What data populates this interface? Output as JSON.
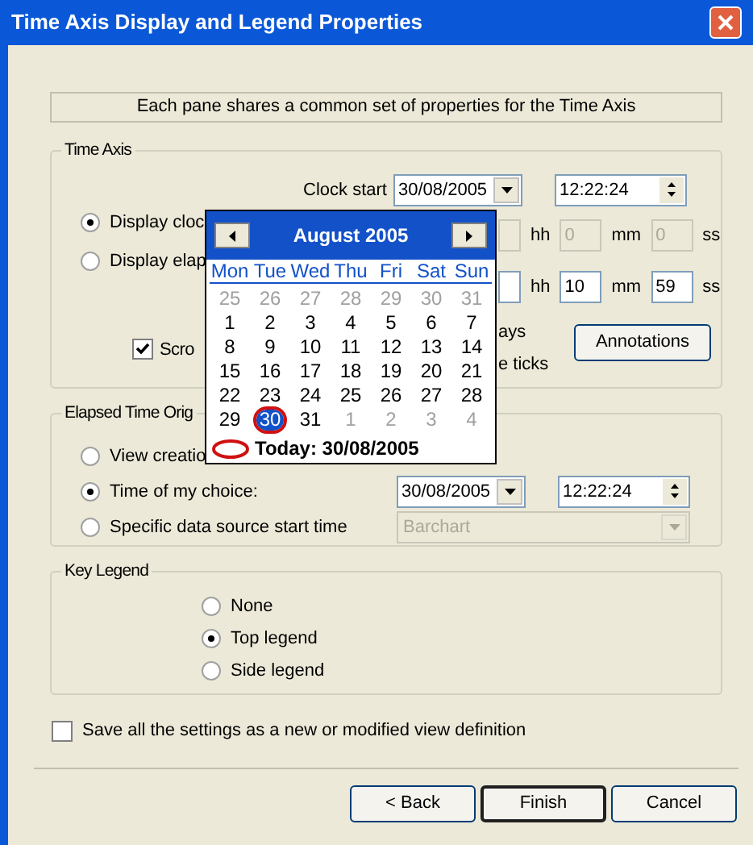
{
  "window": {
    "title": "Time Axis Display and Legend Properties"
  },
  "banner": "Each pane shares a common set of properties for the Time Axis",
  "time_axis": {
    "title": "Time Axis",
    "clock_start": {
      "label": "Clock start",
      "date": "30/08/2005",
      "time": "12:22:24"
    },
    "modes": [
      {
        "label": "Display cloc",
        "selected": true
      },
      {
        "label": "Display elap",
        "selected": false
      }
    ],
    "offset_rows": [
      {
        "disabled": true,
        "items": [
          {
            "kind": "field"
          },
          {
            "kind": "unit",
            "text": "hh"
          },
          {
            "kind": "field",
            "value": "0"
          },
          {
            "kind": "unit",
            "text": "mm"
          },
          {
            "kind": "field",
            "value": "0"
          },
          {
            "kind": "unit",
            "text": "ss"
          }
        ]
      },
      {
        "disabled": false,
        "items": [
          {
            "kind": "field"
          },
          {
            "kind": "unit",
            "text": "hh"
          },
          {
            "kind": "field",
            "value": "10"
          },
          {
            "kind": "unit",
            "text": "mm"
          },
          {
            "kind": "field",
            "value": "59"
          },
          {
            "kind": "unit",
            "text": "ss"
          }
        ]
      }
    ],
    "scroll_checkbox": {
      "label": "Scro",
      "checked": true
    },
    "partial_labels": [
      "ays",
      "e ticks"
    ],
    "annotations_button": "Annotations"
  },
  "elapsed_origin": {
    "title": "Elapsed Time Orig",
    "options": [
      {
        "kind": "plain",
        "label": "View creatio",
        "selected": false
      },
      {
        "kind": "datetime",
        "label": "Time of my choice:",
        "selected": true,
        "date": "30/08/2005",
        "time": "12:22:24"
      },
      {
        "kind": "source",
        "label": "Specific data source start time",
        "selected": false,
        "source": {
          "value": "Barchart",
          "disabled": true
        }
      }
    ]
  },
  "key_legend": {
    "title": "Key Legend",
    "options": [
      {
        "label": "None",
        "selected": false
      },
      {
        "label": "Top legend",
        "selected": true
      },
      {
        "label": "Side legend",
        "selected": false
      }
    ]
  },
  "save_checkbox": {
    "label": "Save all the settings as a new or modified view definition",
    "checked": false
  },
  "buttons": [
    {
      "label": "< Back",
      "default": false
    },
    {
      "label": "Finish",
      "default": true
    },
    {
      "label": "Cancel",
      "default": false
    }
  ],
  "calendar": {
    "month": "August 2005",
    "weekdays": [
      "Mon",
      "Tue",
      "Wed",
      "Thu",
      "Fri",
      "Sat",
      "Sun"
    ],
    "days": [
      {
        "day": "25",
        "other_month": true,
        "selected": false
      },
      {
        "day": "26",
        "other_month": true,
        "selected": false
      },
      {
        "day": "27",
        "other_month": true,
        "selected": false
      },
      {
        "day": "28",
        "other_month": true,
        "selected": false
      },
      {
        "day": "29",
        "other_month": true,
        "selected": false
      },
      {
        "day": "30",
        "other_month": true,
        "selected": false
      },
      {
        "day": "31",
        "other_month": true,
        "selected": false
      },
      {
        "day": "1",
        "other_month": false,
        "selected": false
      },
      {
        "day": "2",
        "other_month": false,
        "selected": false
      },
      {
        "day": "3",
        "other_month": false,
        "selected": false
      },
      {
        "day": "4",
        "other_month": false,
        "selected": false
      },
      {
        "day": "5",
        "other_month": false,
        "selected": false
      },
      {
        "day": "6",
        "other_month": false,
        "selected": false
      },
      {
        "day": "7",
        "other_month": false,
        "selected": false
      },
      {
        "day": "8",
        "other_month": false,
        "selected": false
      },
      {
        "day": "9",
        "other_month": false,
        "selected": false
      },
      {
        "day": "10",
        "other_month": false,
        "selected": false
      },
      {
        "day": "11",
        "other_month": false,
        "selected": false
      },
      {
        "day": "12",
        "other_month": false,
        "selected": false
      },
      {
        "day": "13",
        "other_month": false,
        "selected": false
      },
      {
        "day": "14",
        "other_month": false,
        "selected": false
      },
      {
        "day": "15",
        "other_month": false,
        "selected": false
      },
      {
        "day": "16",
        "other_month": false,
        "selected": false
      },
      {
        "day": "17",
        "other_month": false,
        "selected": false
      },
      {
        "day": "18",
        "other_month": false,
        "selected": false
      },
      {
        "day": "19",
        "other_month": false,
        "selected": false
      },
      {
        "day": "20",
        "other_month": false,
        "selected": false
      },
      {
        "day": "21",
        "other_month": false,
        "selected": false
      },
      {
        "day": "22",
        "other_month": false,
        "selected": false
      },
      {
        "day": "23",
        "other_month": false,
        "selected": false
      },
      {
        "day": "24",
        "other_month": false,
        "selected": false
      },
      {
        "day": "25",
        "other_month": false,
        "selected": false
      },
      {
        "day": "26",
        "other_month": false,
        "selected": false
      },
      {
        "day": "27",
        "other_month": false,
        "selected": false
      },
      {
        "day": "28",
        "other_month": false,
        "selected": false
      },
      {
        "day": "29",
        "other_month": false,
        "selected": false
      },
      {
        "day": "30",
        "other_month": false,
        "selected": true
      },
      {
        "day": "31",
        "other_month": false,
        "selected": false
      },
      {
        "day": "1",
        "other_month": true,
        "selected": false
      },
      {
        "day": "2",
        "other_month": true,
        "selected": false
      },
      {
        "day": "3",
        "other_month": true,
        "selected": false
      },
      {
        "day": "4",
        "other_month": true,
        "selected": false
      }
    ],
    "today": "Today: 30/08/2005"
  }
}
